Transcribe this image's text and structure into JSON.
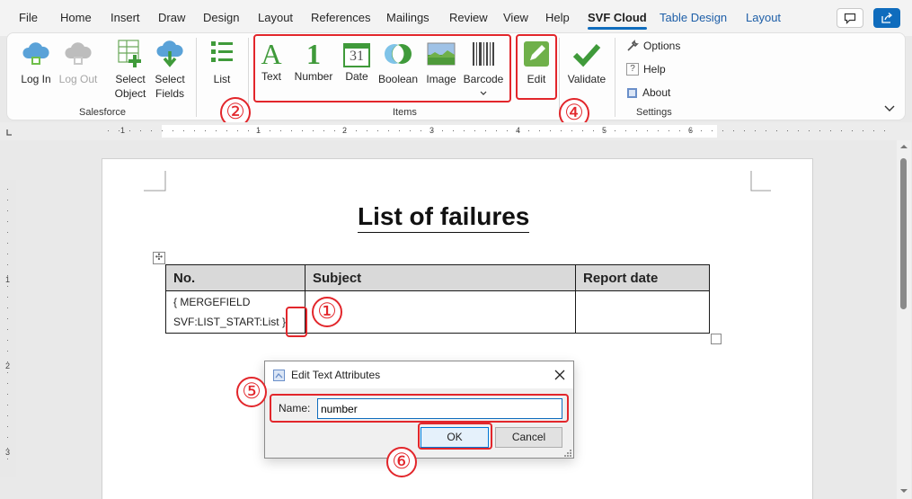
{
  "menu": {
    "tabs": [
      "File",
      "Home",
      "Insert",
      "Draw",
      "Design",
      "Layout",
      "References",
      "Mailings",
      "Review",
      "View",
      "Help",
      "SVF Cloud",
      "Table Design",
      "Layout"
    ],
    "active_tab": "SVF Cloud"
  },
  "topbar": {
    "comments_icon": "comment-icon",
    "share_icon": "share-icon"
  },
  "ribbon": {
    "groups": {
      "salesforce": {
        "label": "Salesforce",
        "buttons": {
          "login": "Log In",
          "logout": "Log Out",
          "select_object_1": "Select",
          "select_object_2": "Object",
          "select_fields_1": "Select",
          "select_fields_2": "Fields"
        }
      },
      "list": {
        "label": "List"
      },
      "items": {
        "label": "Items",
        "buttons": {
          "text": "Text",
          "number": "Number",
          "date": "Date",
          "boolean": "Boolean",
          "image": "Image",
          "barcode": "Barcode",
          "edit": "Edit"
        },
        "date_icon_day": "31",
        "number_icon_glyph": "1",
        "text_icon_glyph": "A"
      },
      "validate": {
        "label": "Validate"
      },
      "settings": {
        "label": "Settings",
        "options": "Options",
        "help": "Help",
        "about": "About",
        "help_icon_glyph": "?"
      }
    },
    "colors": {
      "accent_green": "#3f9a3a",
      "brand_blue": "#0f6cbd",
      "marker_red": "#e2262b"
    }
  },
  "ruler": {
    "numbers": [
      "1",
      "1",
      "2",
      "3",
      "4",
      "5",
      "6"
    ]
  },
  "vruler": {
    "numbers": [
      "1",
      "2",
      "3"
    ]
  },
  "document": {
    "title": "List of failures",
    "table": {
      "headers": [
        "No.",
        "Subject",
        "Report date"
      ],
      "cell_line1": "{ MERGEFIELD",
      "cell_line2": "SVF:LIST_START:List",
      "cell_close": "}"
    }
  },
  "dialog": {
    "title": "Edit Text Attributes",
    "name_label": "Name:",
    "name_value": "number",
    "ok_label": "OK",
    "cancel_label": "Cancel"
  },
  "markers": [
    "①",
    "②",
    "④",
    "⑤",
    "⑥"
  ]
}
